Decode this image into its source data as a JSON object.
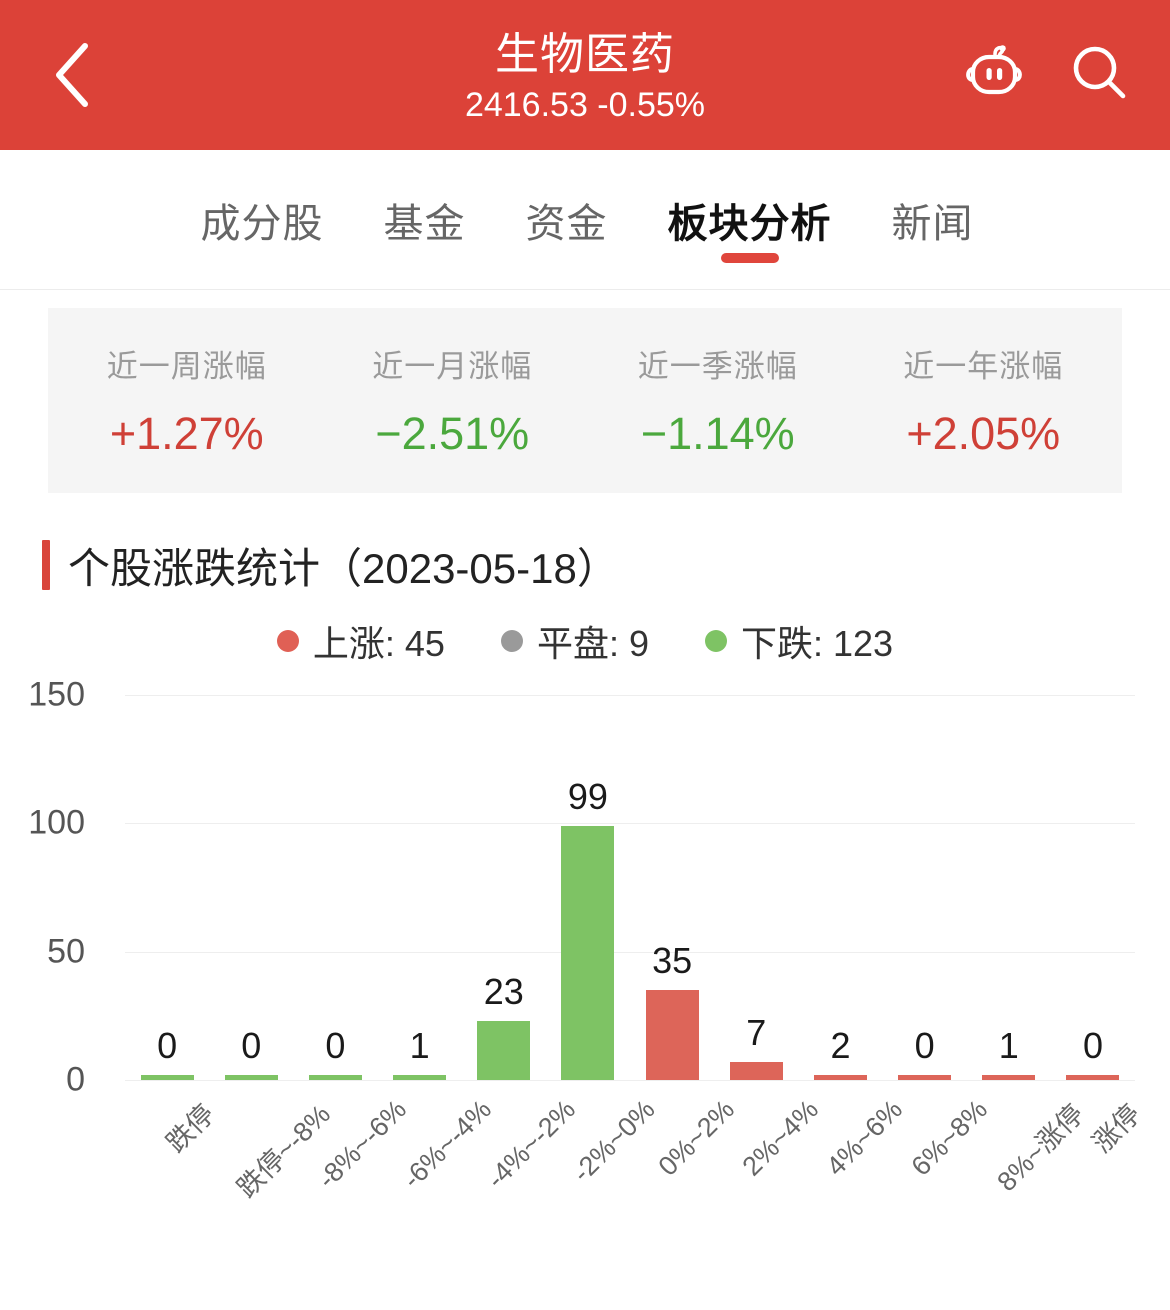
{
  "header": {
    "back_icon": "chevron-left-icon",
    "title": "生物医药",
    "subtitle": "2416.53 -0.55%",
    "robot_icon": "robot-icon",
    "search_icon": "search-icon",
    "background_color": "#dc4238"
  },
  "tabs": [
    {
      "label": "成分股",
      "active": false
    },
    {
      "label": "基金",
      "active": false
    },
    {
      "label": "资金",
      "active": false
    },
    {
      "label": "板块分析",
      "active": true
    },
    {
      "label": "新闻",
      "active": false
    }
  ],
  "stats": [
    {
      "label": "近一周涨幅",
      "value": "+1.27%",
      "direction": "up"
    },
    {
      "label": "近一月涨幅",
      "value": "−2.51%",
      "direction": "down"
    },
    {
      "label": "近一季涨幅",
      "value": "−1.14%",
      "direction": "down"
    },
    {
      "label": "近一年涨幅",
      "value": "+2.05%",
      "direction": "up"
    }
  ],
  "section": {
    "title": "个股涨跌统计（2023-05-18）"
  },
  "colors": {
    "red": "#dd6559",
    "green": "#7ec364",
    "gray": "#9a9a9a",
    "accent": "#d9453b",
    "up_text": "#cf4037",
    "down_text": "#4ba83d"
  },
  "chart_data": {
    "type": "bar",
    "title": "个股涨跌统计（2023-05-18）",
    "xlabel": "",
    "ylabel": "",
    "ylim": [
      0,
      150
    ],
    "yticks": [
      0,
      50,
      100,
      150
    ],
    "ytick_labels": [
      "0",
      "50",
      "100",
      "150"
    ],
    "grid": true,
    "legend_position": "top-center",
    "legend": [
      {
        "name": "上涨",
        "label": "上涨: 45",
        "value": 45,
        "color": "#e06055"
      },
      {
        "name": "平盘",
        "label": "平盘: 9",
        "value": 9,
        "color": "#9a9a9a"
      },
      {
        "name": "下跌",
        "label": "下跌: 123",
        "value": 123,
        "color": "#7ec364"
      }
    ],
    "categories": [
      "跌停",
      "跌停~-8%",
      "-8%~-6%",
      "-6%~-4%",
      "-4%~-2%",
      "-2%~0%",
      "0%~2%",
      "2%~4%",
      "4%~6%",
      "6%~8%",
      "8%~涨停",
      "涨停"
    ],
    "values": [
      0,
      0,
      0,
      1,
      23,
      99,
      35,
      7,
      2,
      0,
      1,
      0
    ],
    "value_labels": [
      "0",
      "0",
      "0",
      "1",
      "23",
      "99",
      "35",
      "7",
      "2",
      "0",
      "1",
      "0"
    ],
    "bar_colors": [
      "#7ec364",
      "#7ec364",
      "#7ec364",
      "#7ec364",
      "#7ec364",
      "#7ec364",
      "#dd6559",
      "#dd6559",
      "#dd6559",
      "#dd6559",
      "#dd6559",
      "#dd6559"
    ]
  }
}
